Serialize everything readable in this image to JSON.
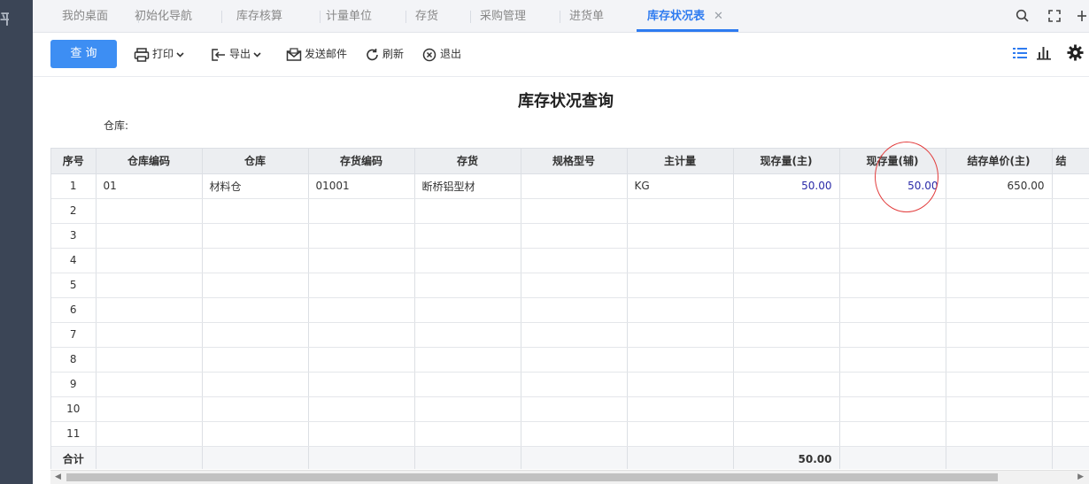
{
  "left_glyph": "平",
  "tabs": [
    {
      "label": "我的桌面"
    },
    {
      "label": "初始化导航"
    },
    {
      "label": "库存核算"
    },
    {
      "label": "计量单位"
    },
    {
      "label": "存货"
    },
    {
      "label": "采购管理"
    },
    {
      "label": "进货单"
    },
    {
      "label": "库存状况表"
    }
  ],
  "toolbar": {
    "query": "查 询",
    "print": "打印",
    "export": "导出",
    "email": "发送邮件",
    "refresh": "刷新",
    "exit": "退出"
  },
  "report": {
    "title": "库存状况查询",
    "warehouse_label": "仓库:"
  },
  "table": {
    "headers": [
      "序号",
      "仓库编码",
      "仓库",
      "存货编码",
      "存货",
      "规格型号",
      "主计量",
      "现存量(主)",
      "现存量(辅)",
      "结存单价(主)",
      "结"
    ],
    "rows": [
      {
        "seq": "1",
        "wh_code": "01",
        "wh": "材料仓",
        "inv_code": "01001",
        "inv": "断桥铝型材",
        "spec": "",
        "unit": "KG",
        "qty_main": "50.00",
        "qty_aux": "50.00",
        "price": "650.00"
      },
      {
        "seq": "2"
      },
      {
        "seq": "3"
      },
      {
        "seq": "4"
      },
      {
        "seq": "5"
      },
      {
        "seq": "6"
      },
      {
        "seq": "7"
      },
      {
        "seq": "8"
      },
      {
        "seq": "9"
      },
      {
        "seq": "10"
      },
      {
        "seq": "11"
      }
    ],
    "total_label": "合计",
    "total_qty_main": "50.00"
  }
}
